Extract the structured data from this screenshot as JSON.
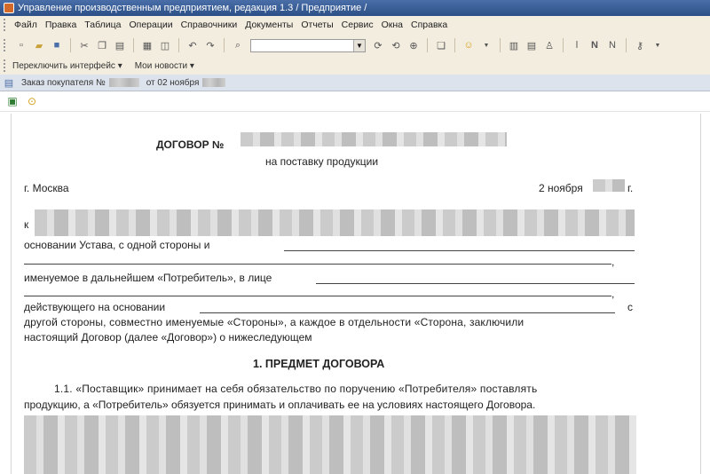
{
  "window": {
    "title": "Управление производственным предприятием, редакция 1.3 / Предприятие /"
  },
  "menu": [
    "Файл",
    "Правка",
    "Таблица",
    "Операции",
    "Справочники",
    "Документы",
    "Отчеты",
    "Сервис",
    "Окна",
    "Справка"
  ],
  "toolbar2": {
    "interface_label": "Переключить интерфейс",
    "new_news_label": "Мои новости"
  },
  "doc_tab": {
    "label": "Заказ покупателя №",
    "date_label": "от 02 ноября"
  },
  "document": {
    "title": "ДОГОВОР №",
    "subtitle": "на поставку продукции",
    "city": "г. Москва",
    "date": "2 ноября",
    "year_suffix": "г.",
    "k_letter": "к",
    "line1": "основании Устава, с одной стороны и",
    "line2": "именуемое в дальнейшем «Потребитель», в лице",
    "line3": "действующего на основании",
    "line3_end": "с",
    "line4": "другой стороны, совместно именуемые «Стороны», а каждое в отдельности «Сторона, заключили",
    "line5": "настоящий Договор (далее «Договор») о нижеследующем",
    "section1_title": "1. ПРЕДМЕТ ДОГОВОРА",
    "p1_line1": "1.1. «Поставщик» принимает на себя обязательство по поручению «Потребителя» поставлять",
    "p1_line2": "продукцию, а «Потребитель» обязуется принимать и оплачивать ее на условиях настоящего Договора."
  }
}
